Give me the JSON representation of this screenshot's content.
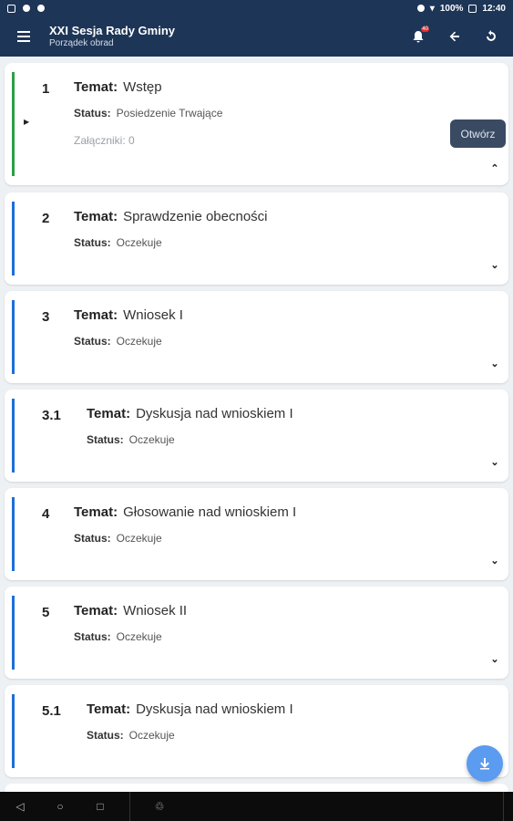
{
  "statusbar": {
    "battery": "100%",
    "time": "12:40"
  },
  "appbar": {
    "title": "XXI Sesja Rady Gminy",
    "subtitle": "Porządek obrad",
    "badge": "40"
  },
  "agenda": [
    {
      "num": "1",
      "topic_label": "Temat:",
      "topic": "Wstęp",
      "status_label": "Status:",
      "status": "Posiedzenie Trwające",
      "attachments": "Załączniki: 0",
      "open_label": "Otwórz"
    },
    {
      "num": "2",
      "topic_label": "Temat:",
      "topic": "Sprawdzenie obecności",
      "status_label": "Status:",
      "status": "Oczekuje"
    },
    {
      "num": "3",
      "topic_label": "Temat:",
      "topic": "Wniosek I",
      "status_label": "Status:",
      "status": "Oczekuje"
    },
    {
      "num": "3.1",
      "topic_label": "Temat:",
      "topic": "Dyskusja nad wnioskiem I",
      "status_label": "Status:",
      "status": "Oczekuje"
    },
    {
      "num": "4",
      "topic_label": "Temat:",
      "topic": "Głosowanie nad wnioskiem I",
      "status_label": "Status:",
      "status": "Oczekuje"
    },
    {
      "num": "5",
      "topic_label": "Temat:",
      "topic": "Wniosek II",
      "status_label": "Status:",
      "status": "Oczekuje"
    },
    {
      "num": "5.1",
      "topic_label": "Temat:",
      "topic": "Dyskusja nad wnioskiem I",
      "status_label": "Status:",
      "status": "Oczekuje"
    }
  ],
  "colors": {
    "appbar": "#1d3557",
    "active_bar": "#2f9e44",
    "pending_bar": "#1e6fd9",
    "fab": "#5b9bf0"
  },
  "icons": {
    "menu": "hamburger-icon",
    "notify": "bell-icon",
    "back": "arrow-left-icon",
    "refresh": "refresh-icon",
    "fab": "download-icon"
  }
}
